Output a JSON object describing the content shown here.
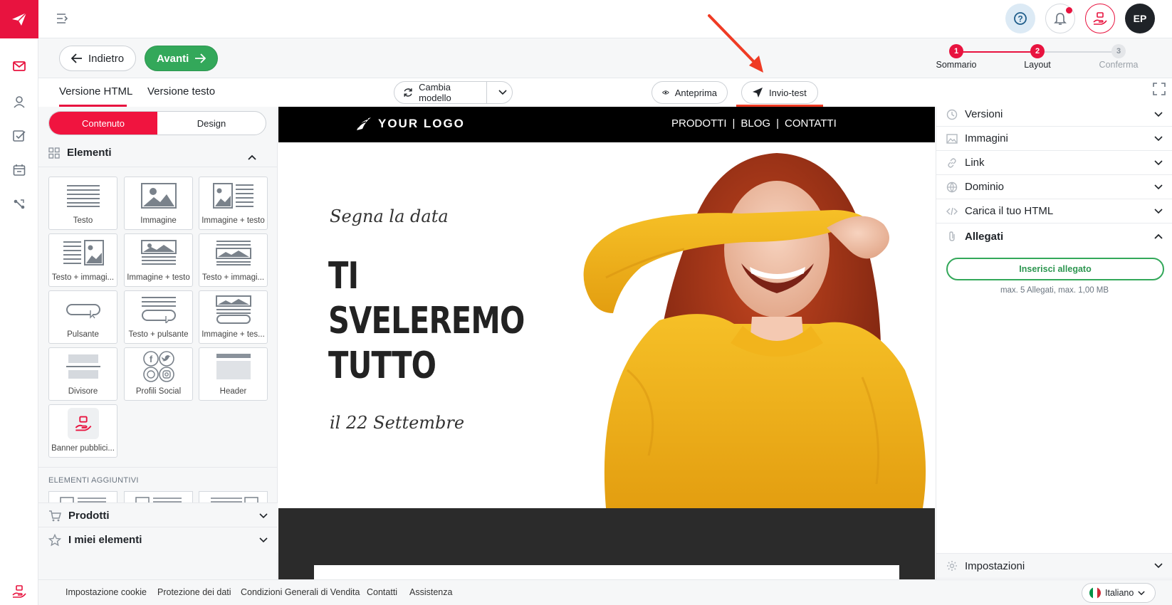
{
  "colors": {
    "brand": "#e8133f",
    "success": "#33a85a",
    "black": "#000000",
    "dark": "#2b2b2b",
    "annotation": "#ef3b24",
    "sweater": "#f1b11d"
  },
  "topbar": {
    "menu_icon": "menu-collapse-icon",
    "help_icon": "help-icon",
    "bell_icon": "bell-icon",
    "promo_icon": "gift-hand-icon",
    "avatar": "EP"
  },
  "nav": {
    "back": "Indietro",
    "next": "Avanti"
  },
  "steps": [
    {
      "number": "1",
      "label": "Sommario",
      "state": "done"
    },
    {
      "number": "2",
      "label": "Layout",
      "state": "current"
    },
    {
      "number": "3",
      "label": "Conferma",
      "state": "todo"
    }
  ],
  "tabs": [
    {
      "label": "Versione HTML",
      "active": true
    },
    {
      "label": "Versione testo",
      "active": false
    }
  ],
  "toolbar": {
    "change_template": "Cambia modello",
    "preview": "Anteprima",
    "test_send": "Invio-test"
  },
  "left_panel": {
    "segments": [
      "Contenuto",
      "Design"
    ],
    "elements_title": "Elementi",
    "tiles": [
      "Testo",
      "Immagine",
      "Immagine + testo",
      "Testo + immagi...",
      "Immagine + testo",
      "Testo + immagi...",
      "Pulsante",
      "Testo + pulsante",
      "Immagine + tes...",
      "Divisore",
      "Profili Social",
      "Header",
      "Banner pubblici..."
    ],
    "additional_title": "ELEMENTI AGGIUNTIVI",
    "products": "Prodotti",
    "my_elements": "I miei elementi"
  },
  "email": {
    "logo": "YOUR LOGO",
    "menu": [
      "PRODOTTI",
      "|",
      "BLOG",
      "|",
      "CONTATTI"
    ],
    "kicker": "Segna la data",
    "headline": [
      "TI",
      "SVELEREMO",
      "TUTTO"
    ],
    "date": "il 22 Settembre"
  },
  "right_panel": {
    "sections": [
      {
        "label": "Versioni",
        "icon": "clock-icon"
      },
      {
        "label": "Immagini",
        "icon": "image-icon"
      },
      {
        "label": "Link",
        "icon": "link-icon"
      },
      {
        "label": "Dominio",
        "icon": "globe-icon"
      },
      {
        "label": "Carica il tuo HTML",
        "icon": "code-icon"
      },
      {
        "label": "Allegati",
        "icon": "paperclip-icon"
      }
    ],
    "attach_button": "Inserisci allegato",
    "attach_note": "max. 5 Allegati, max. 1,00 MB",
    "settings": "Impostazioni"
  },
  "footer": {
    "links": [
      "Impostazione cookie",
      "Protezione dei dati",
      "Condizioni Generali di Vendita",
      "Contatti",
      "Assistenza"
    ],
    "language": "Italiano"
  }
}
